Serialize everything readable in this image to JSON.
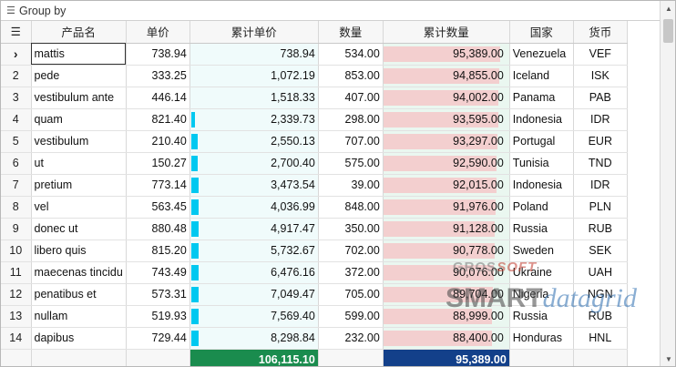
{
  "group_by": {
    "label": "Group by",
    "icon": "hamburger-icon"
  },
  "columns": {
    "row_menu_icon": "hamburger-icon",
    "name": "产品名",
    "price": "单价",
    "cum_price": "累计单价",
    "qty": "数量",
    "cum_qty": "累计数量",
    "country": "国家",
    "currency": "货币"
  },
  "selected_row_icon": "chevron-right-icon",
  "rows": [
    {
      "n": "1",
      "name": "mattis",
      "price": "738.94",
      "price_bar": 0.0,
      "cum": "738.94",
      "qty": "534.00",
      "cumq": "95,389.00",
      "cumq_frac": 1.0,
      "country": "Venezuela",
      "cur": "VEF"
    },
    {
      "n": "2",
      "name": "pede",
      "price": "333.25",
      "price_bar": 0.0,
      "cum": "1,072.19",
      "qty": "853.00",
      "cumq": "94,855.00",
      "cumq_frac": 0.995,
      "country": "Iceland",
      "cur": "ISK"
    },
    {
      "n": "3",
      "name": "vestibulum ante",
      "price": "446.14",
      "price_bar": 0.0,
      "cum": "1,518.33",
      "qty": "407.00",
      "cumq": "94,002.00",
      "cumq_frac": 0.985,
      "country": "Panama",
      "cur": "PAB"
    },
    {
      "n": "4",
      "name": "quam",
      "price": "821.40",
      "price_bar": 0.03,
      "cum": "2,339.73",
      "qty": "298.00",
      "cumq": "93,595.00",
      "cumq_frac": 0.981,
      "country": "Indonesia",
      "cur": "IDR"
    },
    {
      "n": "5",
      "name": "vestibulum",
      "price": "210.40",
      "price_bar": 0.05,
      "cum": "2,550.13",
      "qty": "707.00",
      "cumq": "93,297.00",
      "cumq_frac": 0.978,
      "country": "Portugal",
      "cur": "EUR"
    },
    {
      "n": "6",
      "name": "ut",
      "price": "150.27",
      "price_bar": 0.05,
      "cum": "2,700.40",
      "qty": "575.00",
      "cumq": "92,590.00",
      "cumq_frac": 0.971,
      "country": "Tunisia",
      "cur": "TND"
    },
    {
      "n": "7",
      "name": "pretium",
      "price": "773.14",
      "price_bar": 0.06,
      "cum": "3,473.54",
      "qty": "39.00",
      "cumq": "92,015.00",
      "cumq_frac": 0.965,
      "country": "Indonesia",
      "cur": "IDR"
    },
    {
      "n": "8",
      "name": "vel",
      "price": "563.45",
      "price_bar": 0.06,
      "cum": "4,036.99",
      "qty": "848.00",
      "cumq": "91,976.00",
      "cumq_frac": 0.964,
      "country": "Poland",
      "cur": "PLN"
    },
    {
      "n": "9",
      "name": "donec ut",
      "price": "880.48",
      "price_bar": 0.06,
      "cum": "4,917.47",
      "qty": "350.00",
      "cumq": "91,128.00",
      "cumq_frac": 0.955,
      "country": "Russia",
      "cur": "RUB"
    },
    {
      "n": "10",
      "name": "libero quis",
      "price": "815.20",
      "price_bar": 0.06,
      "cum": "5,732.67",
      "qty": "702.00",
      "cumq": "90,778.00",
      "cumq_frac": 0.952,
      "country": "Sweden",
      "cur": "SEK"
    },
    {
      "n": "11",
      "name": "maecenas tincidu",
      "price": "743.49",
      "price_bar": 0.06,
      "cum": "6,476.16",
      "qty": "372.00",
      "cumq": "90,076.00",
      "cumq_frac": 0.944,
      "country": "Ukraine",
      "cur": "UAH"
    },
    {
      "n": "12",
      "name": "penatibus et",
      "price": "573.31",
      "price_bar": 0.06,
      "cum": "7,049.47",
      "qty": "705.00",
      "cumq": "89,704.00",
      "cumq_frac": 0.94,
      "country": "Nigeria",
      "cur": "NGN"
    },
    {
      "n": "13",
      "name": "nullam",
      "price": "519.93",
      "price_bar": 0.06,
      "cum": "7,569.40",
      "qty": "599.00",
      "cumq": "88,999.00",
      "cumq_frac": 0.933,
      "country": "Russia",
      "cur": "RUB"
    },
    {
      "n": "14",
      "name": "dapibus",
      "price": "729.44",
      "price_bar": 0.06,
      "cum": "8,298.84",
      "qty": "232.00",
      "cumq": "88,400.00",
      "cumq_frac": 0.927,
      "country": "Honduras",
      "cur": "HNL"
    }
  ],
  "footer": {
    "sum_cum_price": "106,115.10",
    "sum_cum_qty": "95,389.00"
  },
  "watermark": {
    "top_a": "GROS",
    "top_b": "SOFT",
    "main_a": "SMART",
    "main_b": "datagrid"
  },
  "colors": {
    "cum_price_bar": "#00c8f0",
    "cum_qty_bar": "#f3cfcf",
    "footer_green": "#1a8c4e",
    "footer_blue": "#13408a"
  }
}
